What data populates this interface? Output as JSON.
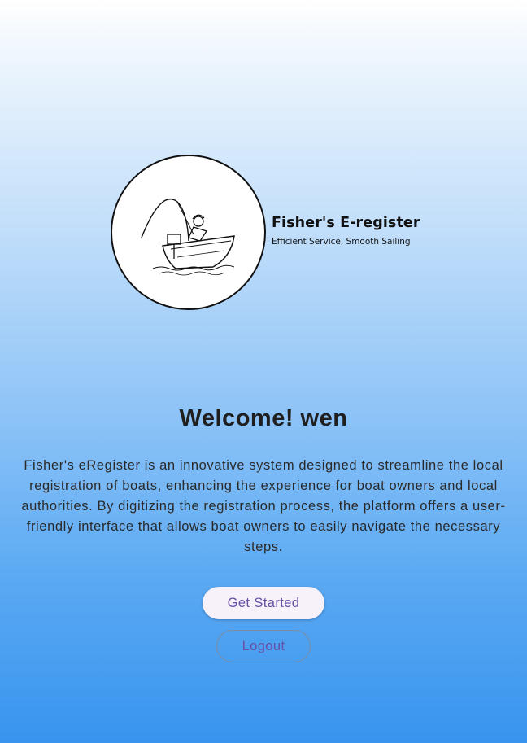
{
  "logo": {
    "icon": "fisherman-boat-icon",
    "title": "Fisher's E-register",
    "tagline": "Efficient Service, Smooth Sailing"
  },
  "welcome": {
    "greeting": "Welcome!",
    "user_name": "wen"
  },
  "description": "Fisher's eRegister is an innovative system designed to streamline the local registration of boats, enhancing the experience for boat owners and local authorities. By digitizing the registration process, the platform offers a user-friendly interface that allows boat owners to easily navigate the necessary steps.",
  "buttons": {
    "get_started": "Get Started",
    "logout": "Logout"
  },
  "colors": {
    "button_text": "#6750a4",
    "gradient_bottom": "#3894ee"
  }
}
